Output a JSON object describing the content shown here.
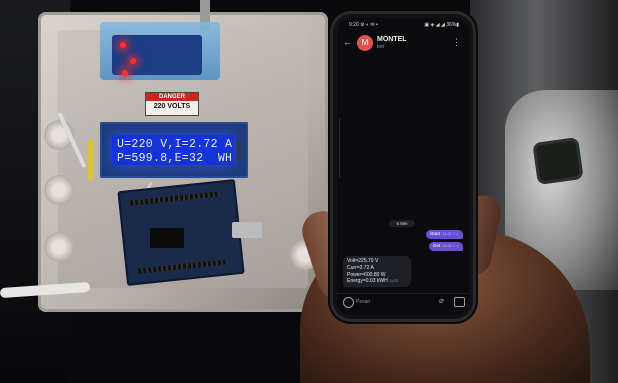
{
  "lcd": {
    "line1": "U=220 V,I=2.72 A",
    "line2": "P=599.8,E=32  WH",
    "color": "#1633d8"
  },
  "sticker": {
    "line1": "DANGER",
    "line2": "220 VOLTS"
  },
  "phone": {
    "status_left": "9:20 ⚙ ◐ ✉ •",
    "status_right": "▣ ◈ ◢ ◢ 36%▮",
    "chat": {
      "contact_name": "MONTEL",
      "contact_initial": "M",
      "contact_subtitle": "bot",
      "date_label": "5 Mei",
      "outgoing": [
        {
          "text": "/start",
          "time": "11:22 ✓✓"
        },
        {
          "text": "Get",
          "time": "11:22 ✓✓"
        }
      ],
      "incoming": {
        "lines": [
          "Volt=225.70 V",
          "Curr=2.72 A",
          "Power=600.80 W",
          "Energy=0.03 kWH"
        ],
        "time": "11:22"
      },
      "input_placeholder": "Pesan"
    },
    "icons": {
      "back": "back-arrow-icon",
      "menu": "more-vertical-icon",
      "emoji": "emoji-icon",
      "attach": "paperclip-icon",
      "camera": "camera-icon"
    }
  },
  "colors": {
    "accent_bubble": "#6a4fd6",
    "avatar": "#e0524e",
    "led_red": "#ff3030"
  }
}
